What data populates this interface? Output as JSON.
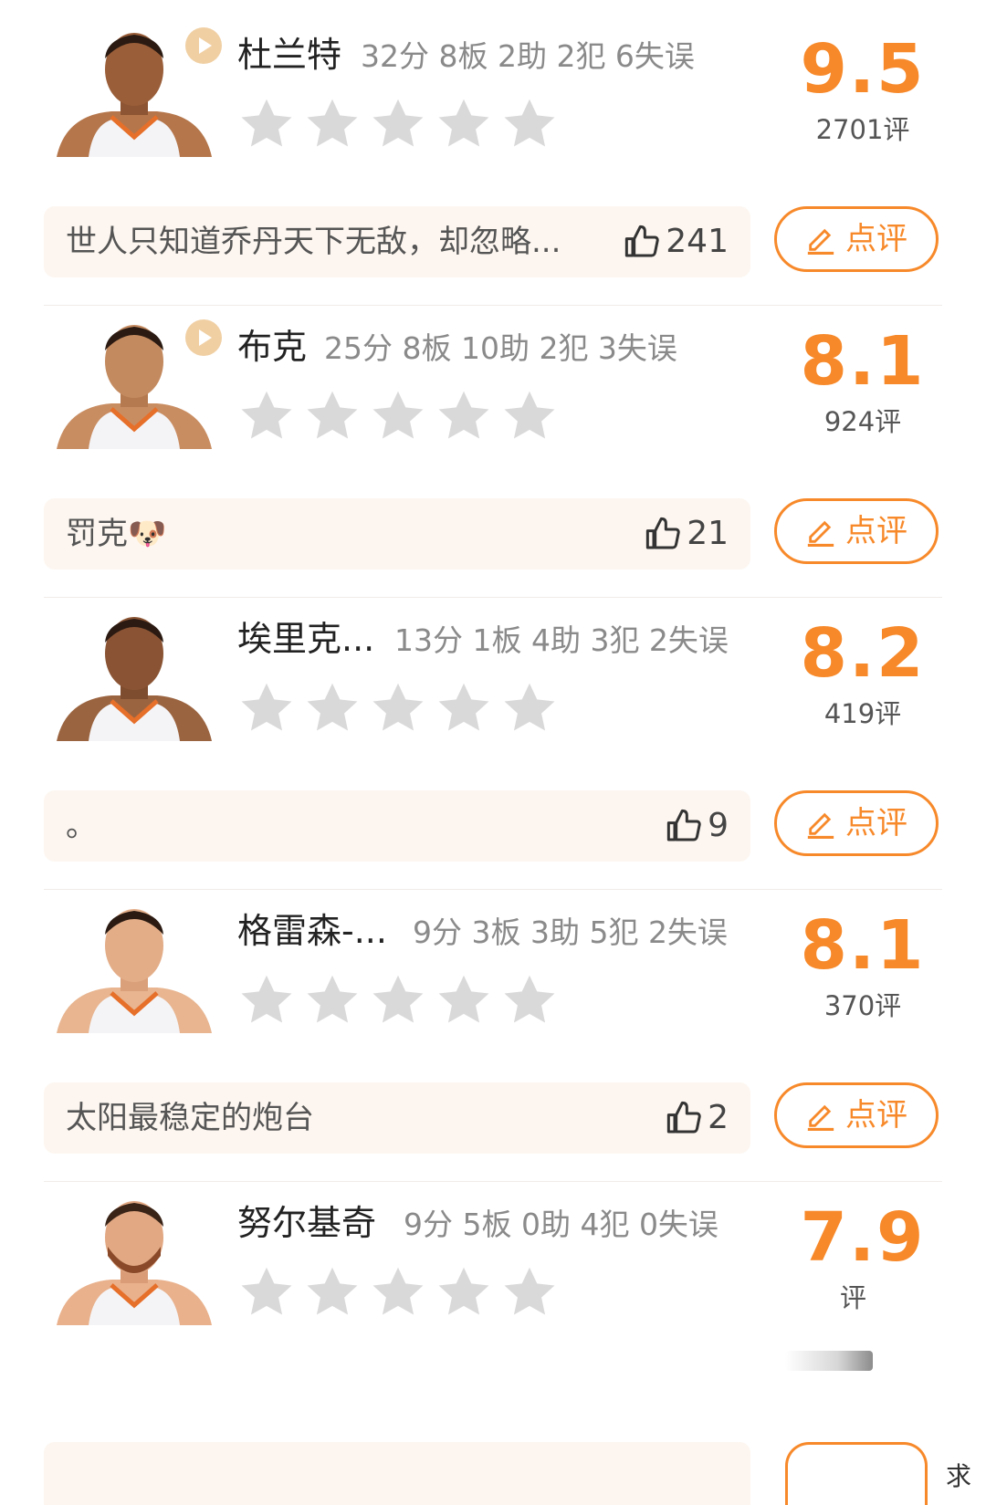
{
  "players": [
    {
      "name": "杜兰特",
      "stats": "32分 8板 2助 2犯 6失误",
      "score": "9.5",
      "count": "2701评",
      "comment": "世人只知道乔丹天下无敌，却忽略...",
      "likes": "241",
      "rate_label": "点评",
      "has_play": true
    },
    {
      "name": "布克",
      "stats": "25分 8板 10助 2犯 3失误",
      "score": "8.1",
      "count": "924评",
      "comment": "罚克🐶",
      "likes": "21",
      "rate_label": "点评",
      "has_play": true
    },
    {
      "name": "埃里克...",
      "stats": "13分 1板 4助 3犯 2失误",
      "score": "8.2",
      "count": "419评",
      "comment": "。",
      "likes": "9",
      "rate_label": "点评",
      "has_play": false
    },
    {
      "name": "格雷森-...",
      "stats": "9分 3板 3助 5犯 2失误",
      "score": "8.1",
      "count": "370评",
      "comment": "太阳最稳定的炮台",
      "likes": "2",
      "rate_label": "点评",
      "has_play": false
    },
    {
      "name": "努尔基奇",
      "stats": "9分 5板 0助 4犯 0失误",
      "score": "7.9",
      "count": "评",
      "has_play": false
    }
  ],
  "watermark": "求",
  "colors": {
    "accent": "#f7892a",
    "comment_bg": "#fdf6f0",
    "star": "#d9d9d9"
  },
  "icons": {
    "play": "play-icon",
    "star": "star-icon",
    "like": "thumbs-up-icon",
    "edit": "pencil-icon"
  }
}
